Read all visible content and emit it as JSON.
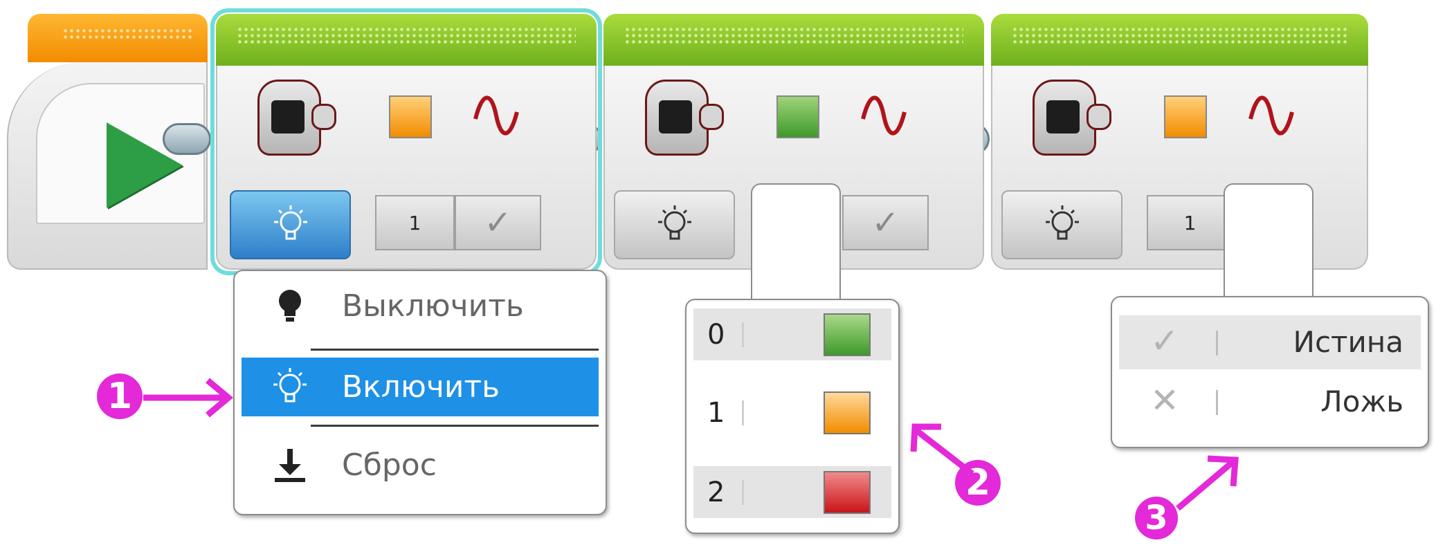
{
  "colors": {
    "start_tab": "#f6a31c",
    "block_tab": "#8cc63f",
    "selection": "#6fdcdc",
    "menu_active": "#1e90e6",
    "annotation": "#e329d8",
    "play": "#2d9e45",
    "color_green": "#5bb033",
    "color_orange": "#f3a22b",
    "color_red": "#d8201f"
  },
  "blocks": [
    {
      "color_input": "orange",
      "color_value": "1",
      "pulse": "check-icon",
      "mode_icon": "bulb-on-icon"
    },
    {
      "color_input": "green",
      "color_value": "",
      "pulse": "check-icon",
      "mode_icon": "bulb-on-icon"
    },
    {
      "color_input": "orange",
      "color_value": "1",
      "pulse": "",
      "mode_icon": "bulb-on-icon"
    }
  ],
  "mode_menu": {
    "items": [
      {
        "label": "Выключить",
        "icon": "bulb-off-icon"
      },
      {
        "label": "Включить",
        "icon": "bulb-on-icon",
        "selected": true
      },
      {
        "label": "Сброс",
        "icon": "download-icon"
      }
    ]
  },
  "color_menu": {
    "options": [
      {
        "value": "0",
        "color": "green"
      },
      {
        "value": "1",
        "color": "orange"
      },
      {
        "value": "2",
        "color": "red"
      }
    ]
  },
  "pulse_menu": {
    "options": [
      {
        "label": "Истина",
        "icon": "check-icon"
      },
      {
        "label": "Ложь",
        "icon": "cross-icon"
      }
    ]
  },
  "annotations": {
    "one": "1",
    "two": "2",
    "three": "3"
  }
}
